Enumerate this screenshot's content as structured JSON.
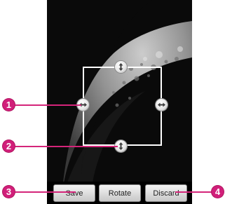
{
  "toolbar": {
    "save_label": "Save",
    "rotate_label": "Rotate",
    "discard_label": "Discard"
  },
  "callouts": {
    "one": "1",
    "two": "2",
    "three": "3",
    "four": "4"
  },
  "colors": {
    "callout": "#d11f7a",
    "background": "#0a0a0a"
  },
  "icons": {
    "horizontal_handle": "left-right-arrow-icon",
    "vertical_handle": "up-down-arrow-icon"
  }
}
